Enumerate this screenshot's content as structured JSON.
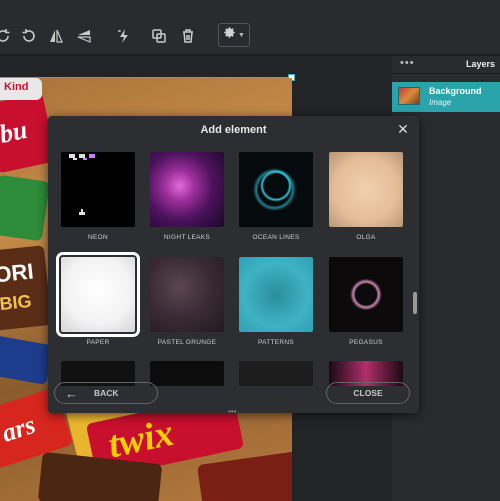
{
  "toolbar": {
    "icons": [
      "undo-icon",
      "redo-icon",
      "flip-horizontal-icon",
      "flip-vertical-icon",
      "magic-icon",
      "duplicate-icon",
      "trash-icon",
      "gear-icon"
    ]
  },
  "layers_panel": {
    "menu_dots": "•••",
    "title": "Layers",
    "items": [
      {
        "name": "Background",
        "type": "Image"
      }
    ]
  },
  "modal": {
    "title": "Add element",
    "close_symbol": "✕",
    "tiles": [
      {
        "label": "NEON"
      },
      {
        "label": "NIGHT LEAKS"
      },
      {
        "label": "OCEAN LINES"
      },
      {
        "label": "OLGA"
      },
      {
        "label": "PAPER",
        "selected": true
      },
      {
        "label": "PASTEL GRUNGE"
      },
      {
        "label": "PATTERNS"
      },
      {
        "label": "PEGASUS"
      }
    ],
    "back_label": "BACK",
    "back_arrow": "←",
    "close_label": "CLOSE",
    "drag_handle": "•••"
  },
  "canvas": {
    "texts": {
      "kinder": "Kind",
      "bueno": "bu",
      "twix": "twix",
      "mars": "ars",
      "big": "BIG",
      "ori": "ORI"
    }
  }
}
